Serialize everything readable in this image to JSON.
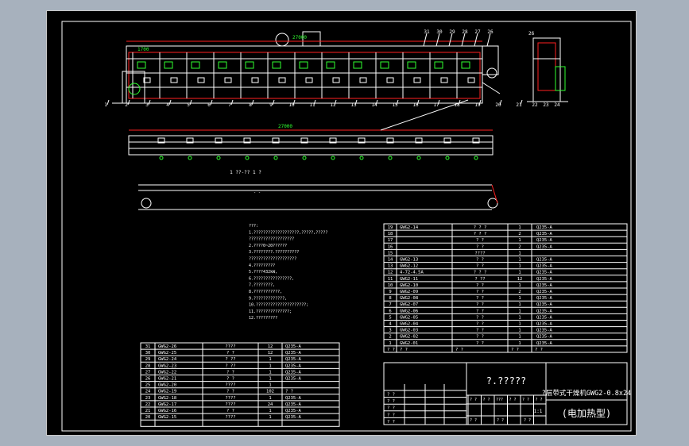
{
  "drawing": {
    "dims": {
      "top_overall": "27000",
      "top_left": "1700",
      "plan_overall": "27000"
    },
    "elevation_callouts": [
      "1",
      "2",
      "3",
      "4",
      "5",
      "6",
      "7",
      "8",
      "9",
      "10",
      "11",
      "12",
      "13",
      "14",
      "15",
      "16",
      "17",
      "18",
      "19",
      "20",
      "21"
    ],
    "top_callouts": [
      "31",
      "30",
      "29",
      "28",
      "27",
      "26"
    ],
    "side_callouts": [
      "22",
      "23",
      "24"
    ],
    "section_label": "1 ??-?? 1 ?",
    "notes": [
      "???:",
      "1.???????????????????,?????,?????",
      "???????????????????",
      "2.????0~20??????",
      "3.????????.??????????",
      "????????????????????",
      "4.?????????",
      "5.????432kW,",
      "6.????????????????,",
      "7.????????,",
      "8.???????????,",
      "9.?????????????,",
      "10.?????????????????????;",
      "11.??????????????;",
      "12.?????????"
    ]
  },
  "bom_right": {
    "rows": [
      {
        "no": "19",
        "code": "GWG2-14",
        "name": "? ? ?",
        "qty": "1",
        "mat": "Q235-A"
      },
      {
        "no": "18",
        "code": "",
        "name": "? ? ?",
        "qty": "2",
        "mat": "Q235-A"
      },
      {
        "no": "17",
        "code": "",
        "name": "? ?",
        "qty": "1",
        "mat": "Q235-A"
      },
      {
        "no": "16",
        "code": "",
        "name": "? ?",
        "qty": "2",
        "mat": "Q235-A"
      },
      {
        "no": "15",
        "code": "",
        "name": "????",
        "qty": "1",
        "mat": ""
      },
      {
        "no": "14",
        "code": "GWG2-13",
        "name": "? ?",
        "qty": "1",
        "mat": "Q235-A"
      },
      {
        "no": "13",
        "code": "GWG2-12",
        "name": "? ?",
        "qty": "1",
        "mat": "Q235-A"
      },
      {
        "no": "12",
        "code": "4-72-4.5A",
        "name": "? ? ?",
        "qty": "1",
        "mat": "Q235-A"
      },
      {
        "no": "11",
        "code": "GWG2-11",
        "name": "? ??",
        "qty": "12",
        "mat": "Q235-A"
      },
      {
        "no": "10",
        "code": "GWG2-10",
        "name": "? ?",
        "qty": "1",
        "mat": "Q235-A"
      },
      {
        "no": "9",
        "code": "GWG2-09",
        "name": "? ?",
        "qty": "2",
        "mat": "Q235-A"
      },
      {
        "no": "8",
        "code": "GWG2-08",
        "name": "? ?",
        "qty": "1",
        "mat": "Q235-A"
      },
      {
        "no": "7",
        "code": "GWG2-07",
        "name": "? ?",
        "qty": "1",
        "mat": "Q235-A"
      },
      {
        "no": "6",
        "code": "GWG2-06",
        "name": "? ?",
        "qty": "1",
        "mat": "Q235-A"
      },
      {
        "no": "5",
        "code": "GWG2-05",
        "name": "? ?",
        "qty": "1",
        "mat": "Q235-A"
      },
      {
        "no": "4",
        "code": "GWG2-04",
        "name": "? ?",
        "qty": "1",
        "mat": "Q235-A"
      },
      {
        "no": "3",
        "code": "GWG2-03",
        "name": "? ?",
        "qty": "1",
        "mat": "Q235-A"
      },
      {
        "no": "2",
        "code": "GWG2-02",
        "name": "? ?",
        "qty": "1",
        "mat": "Q235-A"
      },
      {
        "no": "1",
        "code": "GWG2-01",
        "name": "? ?",
        "qty": "1",
        "mat": "Q235-A"
      }
    ],
    "header": {
      "no": "? ?",
      "code": "? ?",
      "name": "? ?",
      "qty": "? ?",
      "mat": "? ?"
    }
  },
  "bom_left": {
    "rows": [
      {
        "no": "31",
        "code": "GWG2-26",
        "name": "????",
        "qty": "12",
        "mat": "Q235-A"
      },
      {
        "no": "30",
        "code": "GWG2-25",
        "name": "? ?",
        "qty": "12",
        "mat": "Q235-A"
      },
      {
        "no": "29",
        "code": "GWG2-24",
        "name": "? ??",
        "qty": "1",
        "mat": "Q235-A"
      },
      {
        "no": "28",
        "code": "GWG2-23",
        "name": "? ??",
        "qty": "1",
        "mat": "Q235-A"
      },
      {
        "no": "27",
        "code": "GWG2-22",
        "name": "? ?",
        "qty": "1",
        "mat": "Q235-A"
      },
      {
        "no": "26",
        "code": "GWG2-21",
        "name": "? ?",
        "qty": "1",
        "mat": "Q235-A"
      },
      {
        "no": "25",
        "code": "GWG2-20",
        "name": "????",
        "qty": "1",
        "mat": ""
      },
      {
        "no": "24",
        "code": "GWG2-19",
        "name": "? ?",
        "qty": "102",
        "mat": "? ?"
      },
      {
        "no": "23",
        "code": "GWG2-18",
        "name": "????",
        "qty": "1",
        "mat": "Q235-A"
      },
      {
        "no": "22",
        "code": "GWG2-17",
        "name": "????",
        "qty": "24",
        "mat": "Q235-A"
      },
      {
        "no": "21",
        "code": "GWG2-16",
        "name": "? ?",
        "qty": "1",
        "mat": "Q235-A"
      },
      {
        "no": "20",
        "code": "GWG2-15",
        "name": "????",
        "qty": "1",
        "mat": "Q235-A"
      }
    ]
  },
  "title_block": {
    "company": "?.?????",
    "title_line1": "?层带式干燥机GWG2-0.8x24",
    "title_line2": "(电加热型)",
    "sign_rows": [
      "? ?",
      "? ?",
      "? ?",
      "? ?",
      "? ?"
    ],
    "mid_headers": [
      "? ?",
      "? ?",
      "???",
      "? ?",
      "? ?",
      "? ?"
    ],
    "scale_labels": [
      "? ?",
      "? ?",
      "? ?"
    ],
    "sheet_no": "1:1"
  }
}
